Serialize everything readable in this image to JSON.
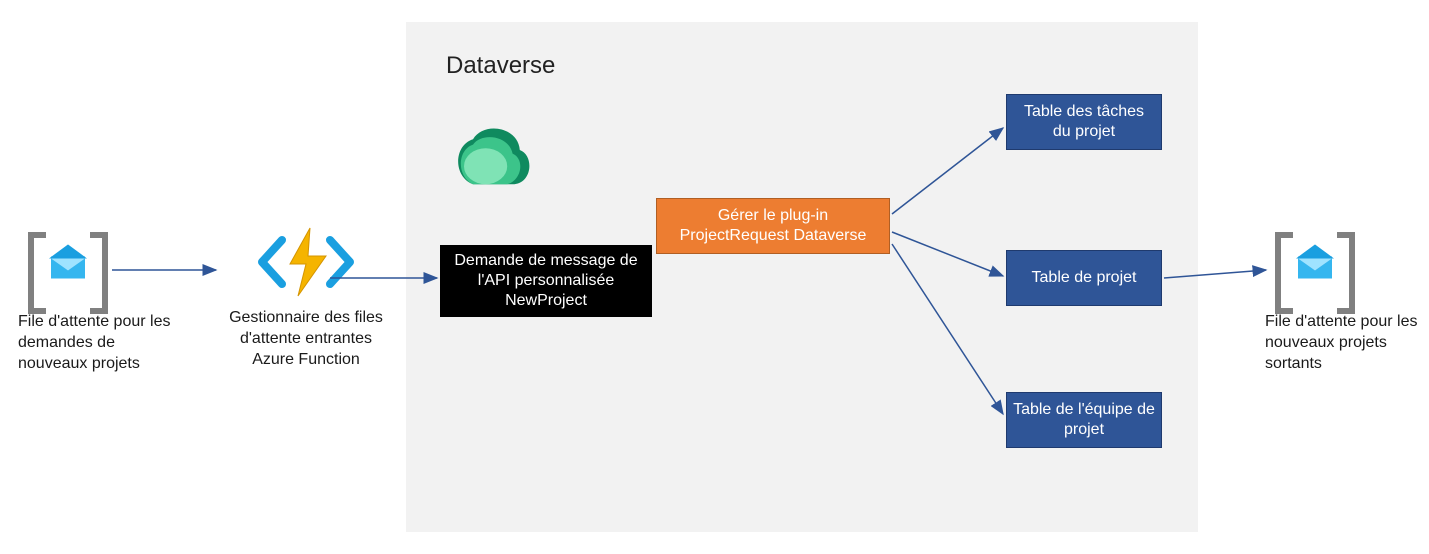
{
  "queue_in_label": "File d'attente pour les demandes de nouveaux projets",
  "azure_fn_label": "Gestionnaire des files d'attente entrantes Azure Function",
  "dataverse_title": "Dataverse",
  "api_box_label": "Demande de message de l'API personnalisée NewProject",
  "plugin_box_label": "Gérer le plug-in ProjectRequest Dataverse",
  "table_tasks_label": "Table des tâches du projet",
  "table_project_label": "Table de projet",
  "table_team_label": "Table de l'équipe de projet",
  "queue_out_label": "File d'attente pour les nouveaux projets sortants"
}
